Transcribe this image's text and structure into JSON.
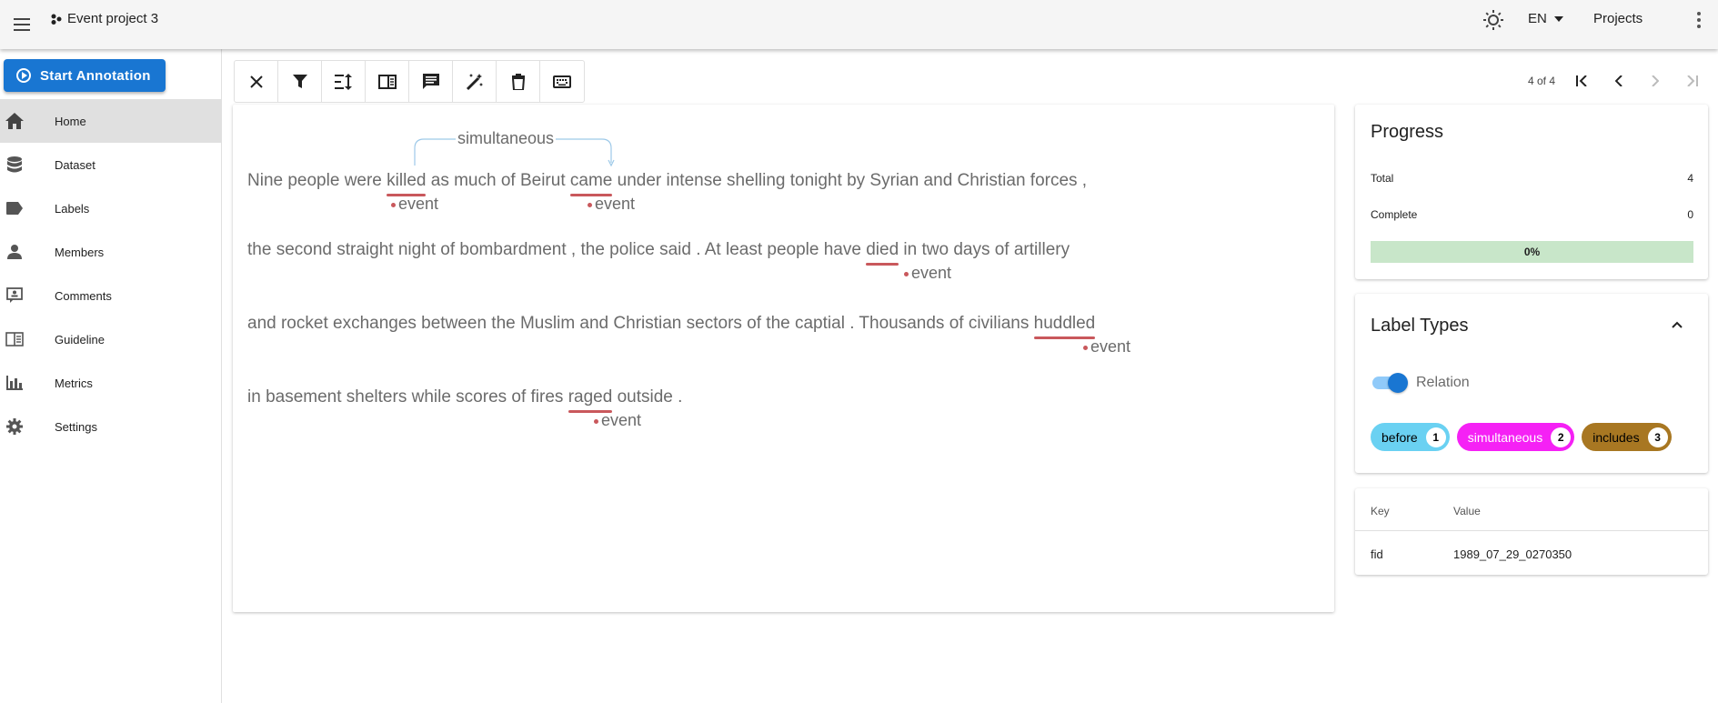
{
  "appbar": {
    "project_name": "Event project 3",
    "language": "EN",
    "projects_label": "Projects"
  },
  "sidebar": {
    "start_annotation": "Start Annotation",
    "items": [
      {
        "label": "Home",
        "icon": "home-icon"
      },
      {
        "label": "Dataset",
        "icon": "database-icon"
      },
      {
        "label": "Labels",
        "icon": "label-icon"
      },
      {
        "label": "Members",
        "icon": "account-icon"
      },
      {
        "label": "Comments",
        "icon": "comment-account-icon"
      },
      {
        "label": "Guideline",
        "icon": "book-open-icon"
      },
      {
        "label": "Metrics",
        "icon": "bar-chart-icon"
      },
      {
        "label": "Settings",
        "icon": "gear-icon"
      }
    ]
  },
  "toolbar": {
    "buttons": [
      "close-icon",
      "filter-icon",
      "sort-icon",
      "book-open-icon",
      "comment-icon",
      "auto-fix-icon",
      "delete-icon",
      "keyboard-icon"
    ]
  },
  "pager": {
    "count": "4 of 4"
  },
  "annotation": {
    "relation_label": "simultaneous",
    "lines": [
      {
        "segments": [
          "Nine people were ",
          "killed",
          " as much of Beirut ",
          "came",
          " under intense shelling tonight by Syrian and Christian forces ,"
        ]
      },
      {
        "segments": [
          "the second straight night of bombardment , the police said . At least people have ",
          "died",
          " in two days of artillery"
        ]
      },
      {
        "segments": [
          "and rocket exchanges between the Muslim and Christian sectors of the captial . Thousands of civilians ",
          "huddled",
          ""
        ]
      },
      {
        "segments": [
          " in basement shelters while scores of fires ",
          "raged",
          " outside ."
        ]
      }
    ],
    "entity_label": "event"
  },
  "progress": {
    "title": "Progress",
    "total_label": "Total",
    "total_value": "4",
    "complete_label": "Complete",
    "complete_value": "0",
    "percent_text": "0%",
    "percent": 0
  },
  "label_types": {
    "title": "Label Types",
    "toggle_label": "Relation",
    "toggle_on": true,
    "chips": [
      {
        "label": "before",
        "count": "1",
        "color": "#6ad1f2",
        "text_color": "#000000"
      },
      {
        "label": "simultaneous",
        "count": "2",
        "color": "#f521f5",
        "text_color": "#ffffff"
      },
      {
        "label": "includes",
        "count": "3",
        "color": "#a87722",
        "text_color": "#000000"
      }
    ]
  },
  "metadata": {
    "key_header": "Key",
    "value_header": "Value",
    "rows": [
      {
        "key": "fid",
        "value": "1989_07_29_0270350"
      }
    ]
  },
  "colors": {
    "primary": "#1976d2",
    "entity_underline": "#c9585c",
    "progress_bar": "#c8e6c9"
  }
}
